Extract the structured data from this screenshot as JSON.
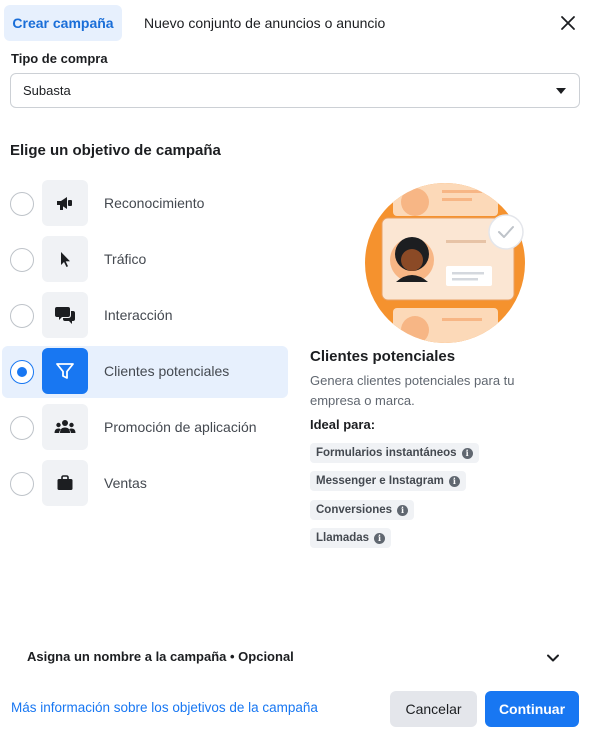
{
  "header": {
    "active_tab": "Crear campaña",
    "second_tab": "Nuevo conjunto de anuncios o anuncio",
    "close_icon": "close-icon"
  },
  "purchase": {
    "label": "Tipo de compra",
    "value": "Subasta"
  },
  "objectives": {
    "title": "Elige un objetivo de campaña",
    "items": [
      {
        "label": "Reconocimiento",
        "icon": "megaphone-icon",
        "selected": false
      },
      {
        "label": "Tráfico",
        "icon": "cursor-icon",
        "selected": false
      },
      {
        "label": "Interacción",
        "icon": "chat-bubbles-icon",
        "selected": false
      },
      {
        "label": "Clientes potenciales",
        "icon": "funnel-icon",
        "selected": true
      },
      {
        "label": "Promoción de aplicación",
        "icon": "people-icon",
        "selected": false
      },
      {
        "label": "Ventas",
        "icon": "shopping-bag-icon",
        "selected": false
      }
    ]
  },
  "detail": {
    "title": "Clientes potenciales",
    "description": "Genera clientes potenciales para tu empresa o marca.",
    "ideal_label": "Ideal para:",
    "chips": [
      "Formularios instantáneos",
      "Messenger e Instagram",
      "Conversiones",
      "Llamadas"
    ]
  },
  "footer": {
    "name_section": "Asigna un nombre a la campaña • Opcional",
    "link": "Más información sobre los objetivos de la campaña",
    "cancel": "Cancelar",
    "continue": "Continuar"
  },
  "colors": {
    "accent": "#1877f2",
    "selected_bg": "#e7f0fd",
    "illustration_orange": "#f5922e"
  }
}
